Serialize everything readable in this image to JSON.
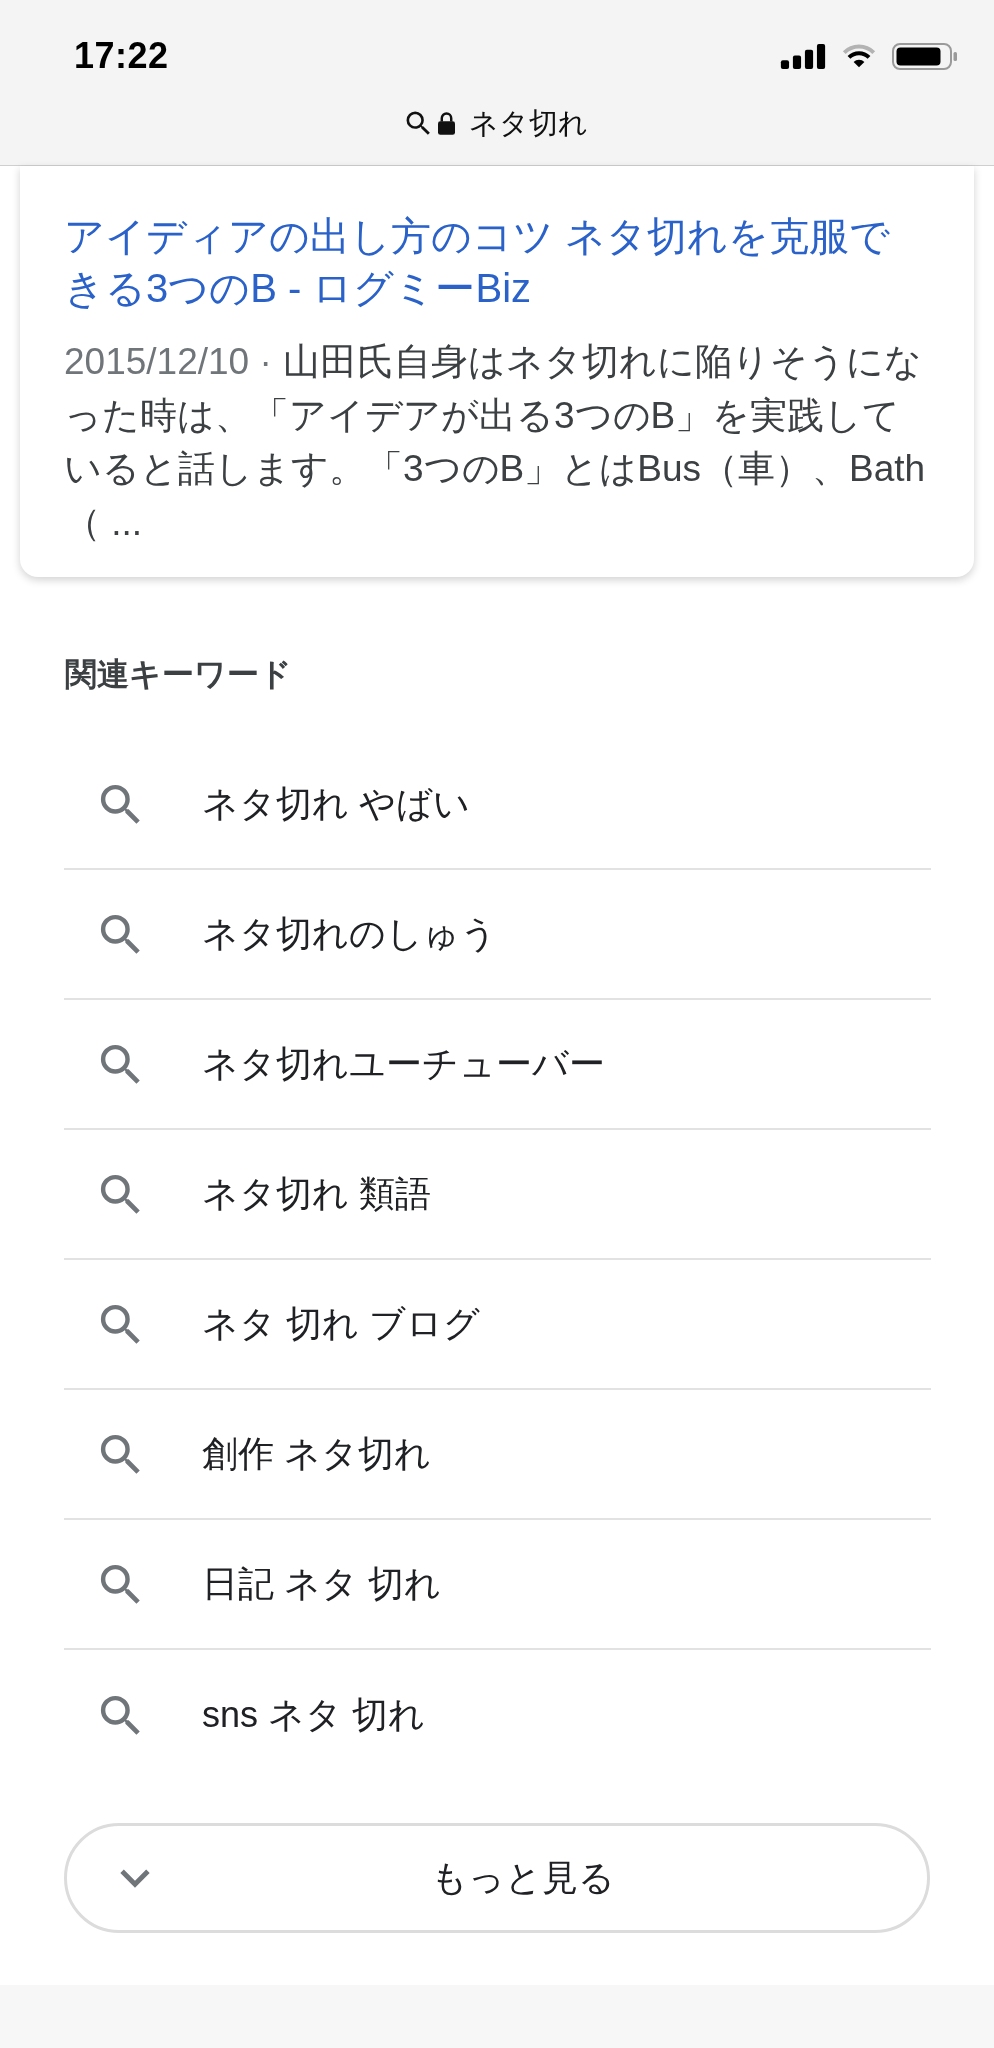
{
  "status_bar": {
    "time": "17:22"
  },
  "address_bar": {
    "query": "ネタ切れ"
  },
  "result": {
    "title": "アイディアの出し方のコツ ネタ切れを克服できる3つのB - ログミーBiz",
    "date": "2015/12/10 ·",
    "snippet": "山田氏自身はネタ切れに陥りそうになった時は、「アイデアが出る3つのB」を実践していると話します。「3つのB」とはBus（車）、Bath（ ..."
  },
  "related_keywords": {
    "heading": "関連キーワード",
    "items": [
      "ネタ切れ やばい",
      "ネタ切れのしゅう",
      "ネタ切れユーチューバー",
      "ネタ切れ 類語",
      "ネタ 切れ ブログ",
      "創作 ネタ切れ",
      "日記 ネタ 切れ",
      "sns ネタ 切れ"
    ]
  },
  "more_button": {
    "label": "もっと見る"
  }
}
